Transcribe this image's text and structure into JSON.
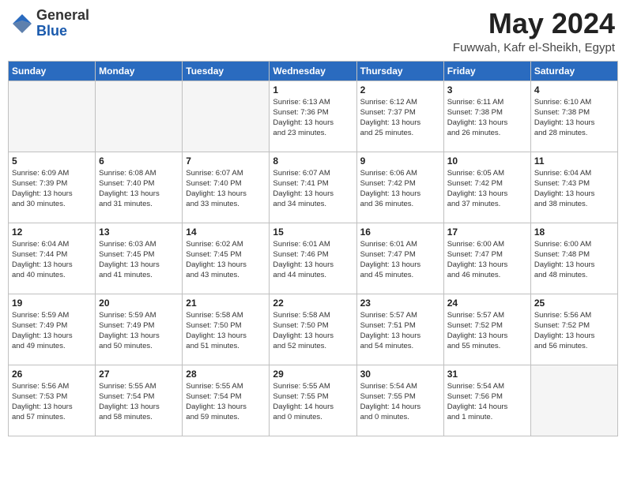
{
  "logo": {
    "general": "General",
    "blue": "Blue"
  },
  "title": "May 2024",
  "location": "Fuwwah, Kafr el-Sheikh, Egypt",
  "weekdays": [
    "Sunday",
    "Monday",
    "Tuesday",
    "Wednesday",
    "Thursday",
    "Friday",
    "Saturday"
  ],
  "weeks": [
    [
      {
        "day": "",
        "info": ""
      },
      {
        "day": "",
        "info": ""
      },
      {
        "day": "",
        "info": ""
      },
      {
        "day": "1",
        "info": "Sunrise: 6:13 AM\nSunset: 7:36 PM\nDaylight: 13 hours\nand 23 minutes."
      },
      {
        "day": "2",
        "info": "Sunrise: 6:12 AM\nSunset: 7:37 PM\nDaylight: 13 hours\nand 25 minutes."
      },
      {
        "day": "3",
        "info": "Sunrise: 6:11 AM\nSunset: 7:38 PM\nDaylight: 13 hours\nand 26 minutes."
      },
      {
        "day": "4",
        "info": "Sunrise: 6:10 AM\nSunset: 7:38 PM\nDaylight: 13 hours\nand 28 minutes."
      }
    ],
    [
      {
        "day": "5",
        "info": "Sunrise: 6:09 AM\nSunset: 7:39 PM\nDaylight: 13 hours\nand 30 minutes."
      },
      {
        "day": "6",
        "info": "Sunrise: 6:08 AM\nSunset: 7:40 PM\nDaylight: 13 hours\nand 31 minutes."
      },
      {
        "day": "7",
        "info": "Sunrise: 6:07 AM\nSunset: 7:40 PM\nDaylight: 13 hours\nand 33 minutes."
      },
      {
        "day": "8",
        "info": "Sunrise: 6:07 AM\nSunset: 7:41 PM\nDaylight: 13 hours\nand 34 minutes."
      },
      {
        "day": "9",
        "info": "Sunrise: 6:06 AM\nSunset: 7:42 PM\nDaylight: 13 hours\nand 36 minutes."
      },
      {
        "day": "10",
        "info": "Sunrise: 6:05 AM\nSunset: 7:42 PM\nDaylight: 13 hours\nand 37 minutes."
      },
      {
        "day": "11",
        "info": "Sunrise: 6:04 AM\nSunset: 7:43 PM\nDaylight: 13 hours\nand 38 minutes."
      }
    ],
    [
      {
        "day": "12",
        "info": "Sunrise: 6:04 AM\nSunset: 7:44 PM\nDaylight: 13 hours\nand 40 minutes."
      },
      {
        "day": "13",
        "info": "Sunrise: 6:03 AM\nSunset: 7:45 PM\nDaylight: 13 hours\nand 41 minutes."
      },
      {
        "day": "14",
        "info": "Sunrise: 6:02 AM\nSunset: 7:45 PM\nDaylight: 13 hours\nand 43 minutes."
      },
      {
        "day": "15",
        "info": "Sunrise: 6:01 AM\nSunset: 7:46 PM\nDaylight: 13 hours\nand 44 minutes."
      },
      {
        "day": "16",
        "info": "Sunrise: 6:01 AM\nSunset: 7:47 PM\nDaylight: 13 hours\nand 45 minutes."
      },
      {
        "day": "17",
        "info": "Sunrise: 6:00 AM\nSunset: 7:47 PM\nDaylight: 13 hours\nand 46 minutes."
      },
      {
        "day": "18",
        "info": "Sunrise: 6:00 AM\nSunset: 7:48 PM\nDaylight: 13 hours\nand 48 minutes."
      }
    ],
    [
      {
        "day": "19",
        "info": "Sunrise: 5:59 AM\nSunset: 7:49 PM\nDaylight: 13 hours\nand 49 minutes."
      },
      {
        "day": "20",
        "info": "Sunrise: 5:59 AM\nSunset: 7:49 PM\nDaylight: 13 hours\nand 50 minutes."
      },
      {
        "day": "21",
        "info": "Sunrise: 5:58 AM\nSunset: 7:50 PM\nDaylight: 13 hours\nand 51 minutes."
      },
      {
        "day": "22",
        "info": "Sunrise: 5:58 AM\nSunset: 7:50 PM\nDaylight: 13 hours\nand 52 minutes."
      },
      {
        "day": "23",
        "info": "Sunrise: 5:57 AM\nSunset: 7:51 PM\nDaylight: 13 hours\nand 54 minutes."
      },
      {
        "day": "24",
        "info": "Sunrise: 5:57 AM\nSunset: 7:52 PM\nDaylight: 13 hours\nand 55 minutes."
      },
      {
        "day": "25",
        "info": "Sunrise: 5:56 AM\nSunset: 7:52 PM\nDaylight: 13 hours\nand 56 minutes."
      }
    ],
    [
      {
        "day": "26",
        "info": "Sunrise: 5:56 AM\nSunset: 7:53 PM\nDaylight: 13 hours\nand 57 minutes."
      },
      {
        "day": "27",
        "info": "Sunrise: 5:55 AM\nSunset: 7:54 PM\nDaylight: 13 hours\nand 58 minutes."
      },
      {
        "day": "28",
        "info": "Sunrise: 5:55 AM\nSunset: 7:54 PM\nDaylight: 13 hours\nand 59 minutes."
      },
      {
        "day": "29",
        "info": "Sunrise: 5:55 AM\nSunset: 7:55 PM\nDaylight: 14 hours\nand 0 minutes."
      },
      {
        "day": "30",
        "info": "Sunrise: 5:54 AM\nSunset: 7:55 PM\nDaylight: 14 hours\nand 0 minutes."
      },
      {
        "day": "31",
        "info": "Sunrise: 5:54 AM\nSunset: 7:56 PM\nDaylight: 14 hours\nand 1 minute."
      },
      {
        "day": "",
        "info": ""
      }
    ]
  ]
}
